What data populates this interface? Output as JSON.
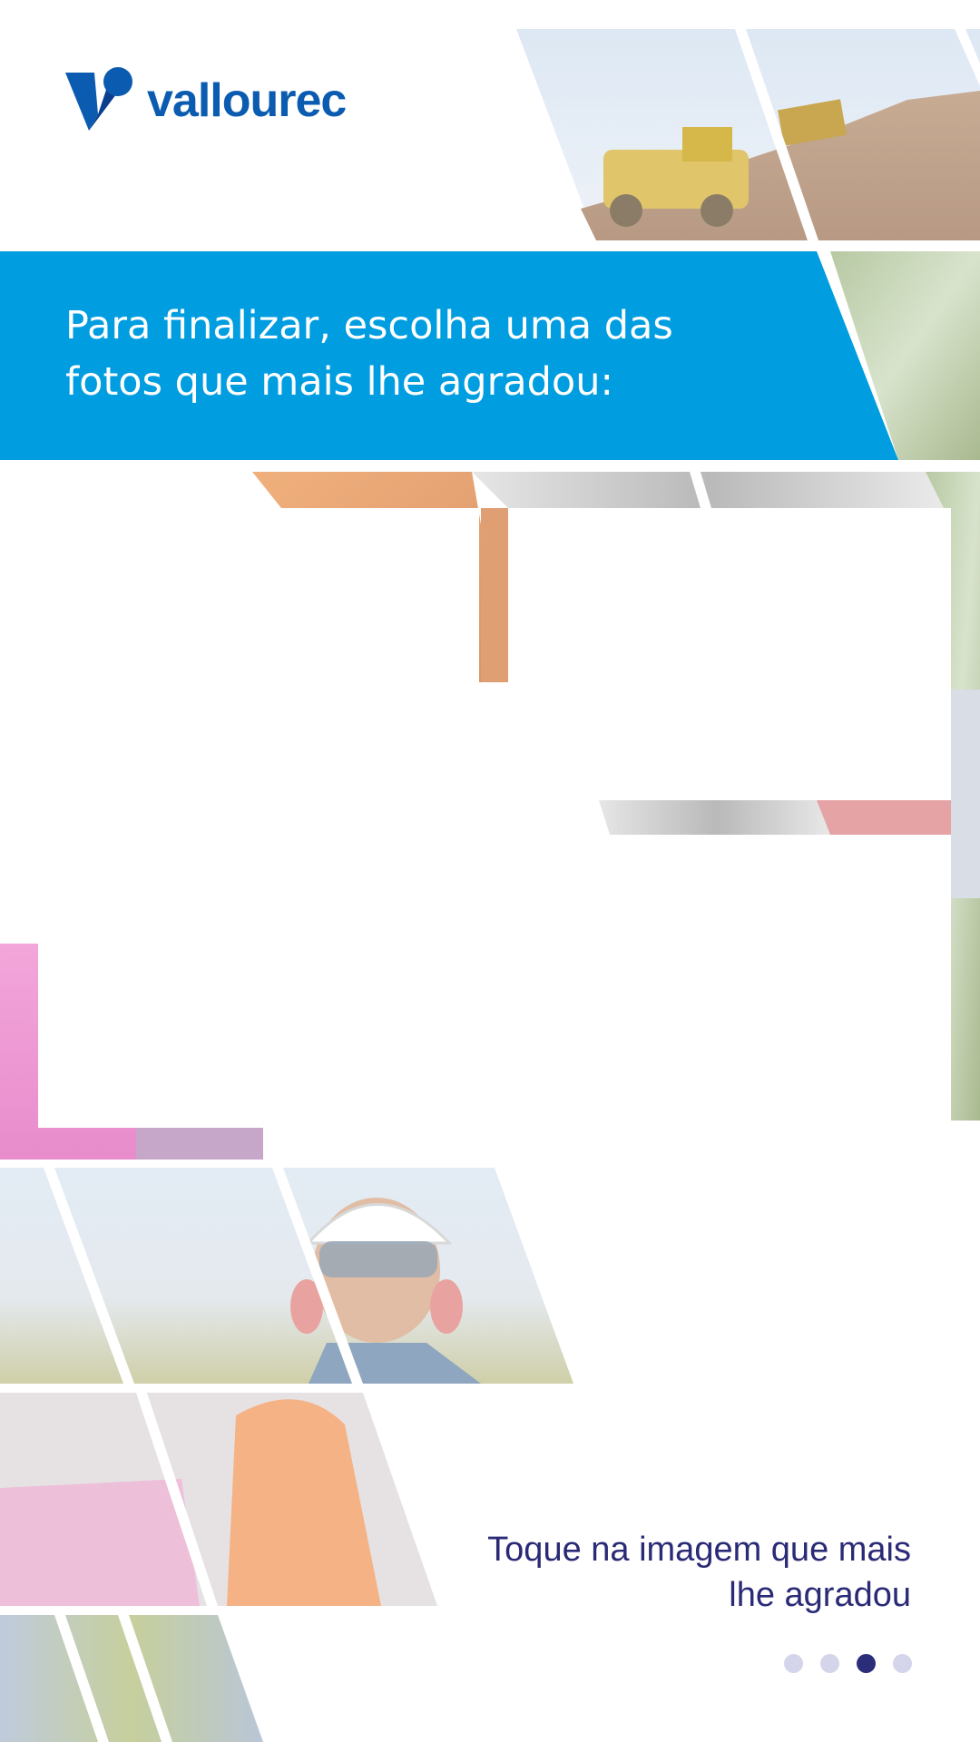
{
  "brand": {
    "name": "vallourec",
    "color": "#0b5cb0"
  },
  "banner": {
    "title": "Para finalizar, escolha uma das fotos que mais lhe agradou:",
    "background": "#009de0",
    "text_color": "#ffffff"
  },
  "instruction": {
    "text": "Toque na imagem que mais lhe agradou",
    "color": "#2a2a76"
  },
  "carousel": {
    "dots": [
      {
        "label": "page 1",
        "active": false
      },
      {
        "label": "page 2",
        "active": false
      },
      {
        "label": "page 3",
        "active": true
      },
      {
        "label": "page 4",
        "active": false
      }
    ],
    "active_color": "#2b2d78",
    "inactive_color": "#d4d5ea"
  },
  "photos": [
    {
      "name": "photo-loader-quarry",
      "subject": "yellow wheel loader on gravel pile"
    },
    {
      "name": "photo-forest",
      "subject": "forest trees"
    },
    {
      "name": "photo-copper-pipes",
      "subject": "orange metal pipes"
    },
    {
      "name": "photo-pipe-threads",
      "subject": "threaded steel pipes"
    },
    {
      "name": "photo-pink-tubes",
      "subject": "pink coated tubes"
    },
    {
      "name": "photo-worker-helmet",
      "subject": "worker with white vallourec helmet and goggles"
    },
    {
      "name": "photo-worker-orange",
      "subject": "worker in orange jacket"
    },
    {
      "name": "photo-solar-panels",
      "subject": "solar panels on grass"
    }
  ]
}
